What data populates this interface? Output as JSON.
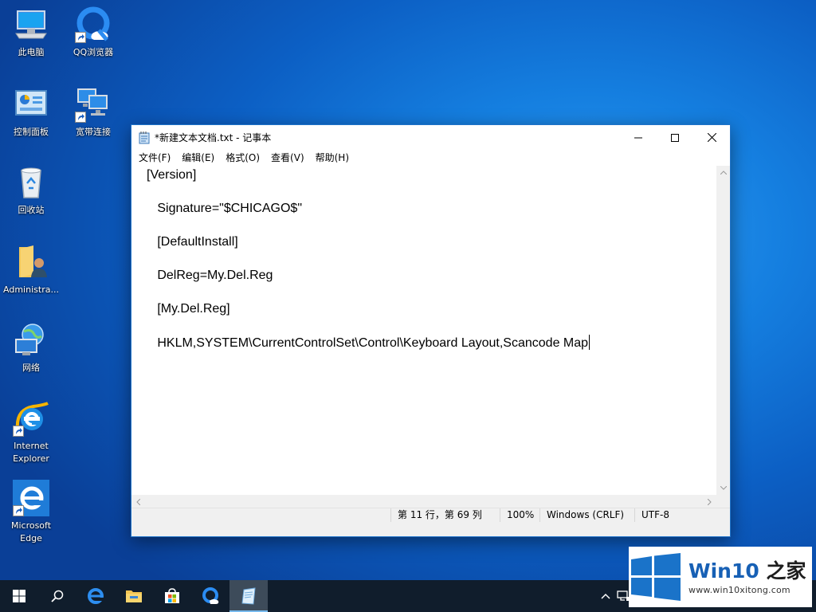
{
  "desktop": {
    "icons": [
      {
        "label": "此电脑"
      },
      {
        "label": "QQ浏览器"
      },
      {
        "label": "控制面板"
      },
      {
        "label": "宽带连接"
      },
      {
        "label": "回收站"
      },
      {
        "label": "Administra..."
      },
      {
        "label": "网络"
      },
      {
        "label": "Internet Explorer"
      },
      {
        "label": "Microsoft Edge"
      }
    ]
  },
  "notepad": {
    "title": "*新建文本文档.txt - 记事本",
    "menu": [
      "文件(F)",
      "编辑(E)",
      "格式(O)",
      "查看(V)",
      "帮助(H)"
    ],
    "lines": [
      "[Version]",
      "   Signature=\"$CHICAGO$\"",
      "   [DefaultInstall]",
      "   DelReg=My.Del.Reg",
      "   [My.Del.Reg]",
      "   HKLM,SYSTEM\\CurrentControlSet\\Control\\Keyboard Layout,Scancode Map"
    ],
    "status": {
      "position": "第 11 行，第 69 列",
      "zoom": "100%",
      "line_ending": "Windows (CRLF)",
      "encoding": "UTF-8"
    }
  },
  "watermark": {
    "brand": "Win10",
    "brand_suffix": "之家",
    "url": "www.win10xitong.com"
  },
  "colors": {
    "accent": "#0078d7",
    "taskbar": "#101d2c"
  }
}
